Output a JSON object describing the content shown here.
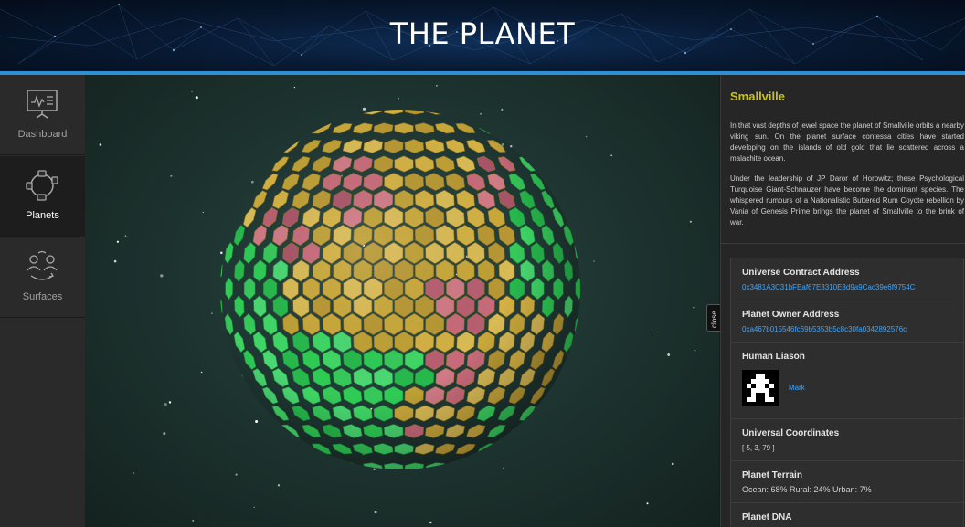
{
  "header": {
    "title": "THE PLANET"
  },
  "sidebar": {
    "items": [
      {
        "label": "Dashboard",
        "icon": "dashboard-icon",
        "active": false
      },
      {
        "label": "Planets",
        "icon": "planets-icon",
        "active": true
      },
      {
        "label": "Surfaces",
        "icon": "surfaces-icon",
        "active": false
      }
    ]
  },
  "viewport": {
    "close_label": "close"
  },
  "panel": {
    "planet_name": "Smallville",
    "description_1": "In that vast depths of jewel space the planet of Smallville orbits a nearby viking sun. On the planet surface contessa cities have started developing on the islands of old gold that lie scattered across a malachite ocean.",
    "description_2": "Under the leadership of JP Daror of Horowitz; these Psychological Turquoise Giant-Schnauzer have become the dominant species. The whispered rumours of a Nationalistic Buttered Rum Coyote rebellion by Vania of Genesis Prime brings the planet of Smallville to the brink of war.",
    "universe_contract": {
      "label": "Universe Contract Address",
      "value": "0x3481A3C31bFEaf67E3310E8d9a9Cac39e6f9754C"
    },
    "planet_owner": {
      "label": "Planet Owner Address",
      "value": "0xa467b015546fc69b5353b5c8c30fa0342892576c"
    },
    "human_liason": {
      "label": "Human Liason",
      "name": "Mark"
    },
    "coordinates": {
      "label": "Universal Coordinates",
      "value": "[ 5, 3, 79 ]"
    },
    "terrain": {
      "label": "Planet Terrain",
      "value": "Ocean: 68% Rural: 24% Urban: 7%"
    },
    "dna": {
      "label": "Planet DNA"
    }
  },
  "colors": {
    "accent_rule": "#2f8fd4",
    "planet_name": "#c8c21f",
    "link": "#3aa6ff",
    "ocean": "#2ecc55",
    "rural": "#c9a83a",
    "urban": "#c86a7a"
  }
}
